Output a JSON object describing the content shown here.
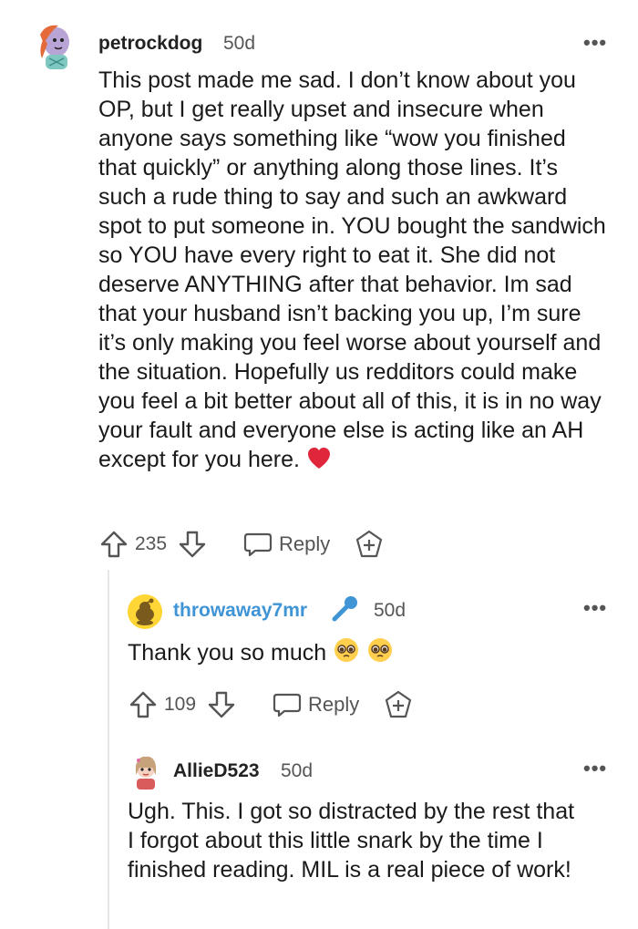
{
  "comments": [
    {
      "username": "petrockdog",
      "timestamp": "50d",
      "body": "This post made me sad. I don’t know about you OP, but I get really upset and insecure when anyone says something like “wow you finished that quickly” or anything along those lines. It’s such a rude thing to say and such an awkward spot to put someone in. YOU bought the sandwich so YOU have every right to eat it. She did not deserve ANYTHING after that behavior. Im sad that your husband isn’t backing you up, I’m sure it’s only making you feel worse about yourself and the situation. Hopefully us redditors could make you feel a bit better about all of this, it is in no way your fault and everyone else is acting like an AH except for you here.",
      "body_emoji": "red-heart",
      "votes": "235",
      "reply_label": "Reply",
      "more_label": "•••"
    },
    {
      "username": "throwaway7mr",
      "is_op": true,
      "op_icon": "microphone-icon",
      "timestamp": "50d",
      "body": "Thank you so much",
      "body_emoji": "pleading-face x2",
      "votes": "109",
      "reply_label": "Reply",
      "more_label": "•••"
    },
    {
      "username": "AllieD523",
      "timestamp": "50d",
      "body": "Ugh. This. I got so distracted by the rest that I forgot about this little snark by the time I finished reading. MIL is a real piece of work!",
      "more_label": "•••"
    }
  ],
  "colors": {
    "op_username": "#3f94d6",
    "heart": "#e0263b",
    "text": "#1a1a1b",
    "muted": "#555555",
    "thread_line": "#e6e6e6"
  }
}
